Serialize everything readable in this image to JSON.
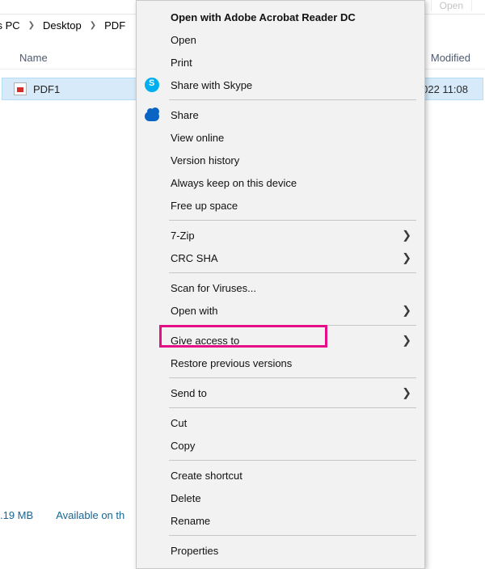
{
  "toolbar": {
    "open_label": "Open"
  },
  "breadcrumbs": {
    "seg1": "'s PC",
    "seg2": "Desktop",
    "seg3": "PDF"
  },
  "columns": {
    "name": "Name",
    "modified": "Modified"
  },
  "row": {
    "filename": "PDF1",
    "modified_tail": "022 11:08"
  },
  "status": {
    "size": ".19 MB",
    "avail": "Available on th"
  },
  "menu": {
    "open_adobe": "Open with Adobe Acrobat Reader DC",
    "open": "Open",
    "print": "Print",
    "share_skype": "Share with Skype",
    "share": "Share",
    "view_online": "View online",
    "version_history": "Version history",
    "always_keep": "Always keep on this device",
    "free_up": "Free up space",
    "seven_zip": "7-Zip",
    "crc_sha": "CRC SHA",
    "scan_viruses": "Scan for Viruses...",
    "open_with": "Open with",
    "give_access": "Give access to",
    "restore_prev": "Restore previous versions",
    "send_to": "Send to",
    "cut": "Cut",
    "copy": "Copy",
    "create_shortcut": "Create shortcut",
    "delete": "Delete",
    "rename": "Rename",
    "properties": "Properties"
  },
  "highlight": {
    "color": "#e40e86"
  }
}
